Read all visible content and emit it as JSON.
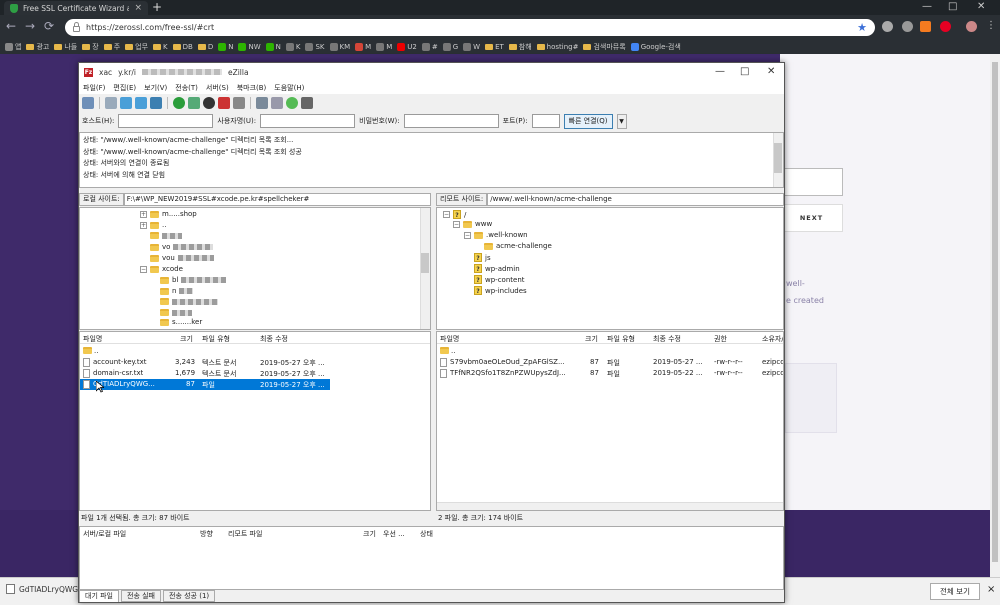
{
  "browser": {
    "tab_title": "Free SSL Certificate Wizard and",
    "new_tab": "+",
    "window_controls": [
      "—",
      "□",
      "✕"
    ],
    "url": "https://zerossl.com/free-ssl/#crt",
    "bookmarks": [
      {
        "label": "앱",
        "icon": "apps-icon"
      },
      {
        "label": "광고",
        "icon": "folder-icon"
      },
      {
        "label": "나들",
        "icon": "folder-icon"
      },
      {
        "label": "장",
        "icon": "folder-icon"
      },
      {
        "label": "주",
        "icon": "folder-icon"
      },
      {
        "label": "업무",
        "icon": "folder-icon"
      },
      {
        "label": "K",
        "icon": "folder-icon"
      },
      {
        "label": "DB",
        "icon": "folder-icon"
      },
      {
        "label": "D",
        "icon": "folder-icon"
      },
      {
        "label": "N",
        "icon": "naver-icon"
      },
      {
        "label": "NW",
        "icon": "naver-icon"
      },
      {
        "label": "N",
        "icon": "naver-icon"
      },
      {
        "label": "K",
        "icon": "site-icon"
      },
      {
        "label": "SK",
        "icon": "site-icon"
      },
      {
        "label": "KM",
        "icon": "site-icon"
      },
      {
        "label": "M",
        "icon": "gmail-icon"
      },
      {
        "label": "M",
        "icon": "site-icon"
      },
      {
        "label": "U2",
        "icon": "youtube-icon"
      },
      {
        "label": "#",
        "icon": "site-icon"
      },
      {
        "label": "G",
        "icon": "site-icon"
      },
      {
        "label": "W",
        "icon": "site-icon"
      },
      {
        "label": "ET",
        "icon": "folder-icon"
      },
      {
        "label": "참해",
        "icon": "folder-icon"
      },
      {
        "label": "hosting#",
        "icon": "folder-icon"
      },
      {
        "label": "검색마뮤록",
        "icon": "folder-icon"
      },
      {
        "label": "Google-검색",
        "icon": "google-icon"
      }
    ],
    "download": {
      "filename": "GdTIADLryQWG...",
      "show_all": "전체 보기"
    }
  },
  "webpage": {
    "next_label": "NEXT",
    "text_frag1": "well-",
    "text_frag2": "e created"
  },
  "filezilla": {
    "title_prefix": "xac",
    "title_mid": "y.kr/i",
    "title_suffix": "eZilla",
    "menu": [
      "파일(F)",
      "편집(E)",
      "보기(V)",
      "전송(T)",
      "서버(S)",
      "북마크(B)",
      "도움말(H)"
    ],
    "quick": {
      "host_label": "호스트(H):",
      "user_label": "사용자명(U):",
      "pass_label": "비밀번호(W):",
      "port_label": "포트(P):",
      "connect_label": "빠른 연결(Q)"
    },
    "log": [
      "상태:  \"/www/.well-known/acme-challenge\" 디렉터리 목록 조회...",
      "상태:  \"/www/.well-known/acme-challenge\" 디렉터리 목록 조회 성공",
      "상태:  서버와의 연결이 종료됨",
      "상태:  서버에 의해 연결 닫힘"
    ],
    "local": {
      "path_label": "로컬 사이트:",
      "path": "F:\\#\\WP_NEW2019#SSL#xcode.pe.kr#spellcheker#",
      "tree": [
        {
          "label": "m.....shop",
          "exp": "+"
        },
        {
          "label": "..",
          "exp": "+"
        },
        {
          "label": "vo",
          "exp": ""
        },
        {
          "label": "vou",
          "exp": ""
        },
        {
          "label": "xcode",
          "exp": "−"
        },
        {
          "label": "bl",
          "exp": ""
        },
        {
          "label": "n",
          "exp": ""
        },
        {
          "label": "",
          "exp": ""
        },
        {
          "label": "",
          "exp": ""
        },
        {
          "label": "s.......ker",
          "exp": ""
        }
      ],
      "columns": [
        "파일명",
        "크기",
        "파일 유형",
        "최종 수정"
      ],
      "files": [
        {
          "name": "..",
          "size": "",
          "type": "",
          "modified": ""
        },
        {
          "name": "account-key.txt",
          "size": "3,243",
          "type": "텍스트 문서",
          "modified": "2019-05-27 오후 ..."
        },
        {
          "name": "domain-csr.txt",
          "size": "1,679",
          "type": "텍스트 문서",
          "modified": "2019-05-27 오후 ..."
        },
        {
          "name": "GdTIADLryQWG...",
          "size": "87",
          "type": "파일",
          "modified": "2019-05-27 오후 ..."
        }
      ],
      "status": "파일 1개 선택됨. 총 크기: 87 바이트"
    },
    "remote": {
      "path_label": "리모트 사이트:",
      "path": "/www/.well-known/acme-challenge",
      "tree": [
        {
          "label": "/",
          "kind": "q"
        },
        {
          "label": "www",
          "kind": "folder"
        },
        {
          "label": ".well-known",
          "kind": "folder"
        },
        {
          "label": "acme-challenge",
          "kind": "folder"
        },
        {
          "label": "js",
          "kind": "q"
        },
        {
          "label": "wp-admin",
          "kind": "q"
        },
        {
          "label": "wp-content",
          "kind": "q"
        },
        {
          "label": "wp-includes",
          "kind": "q"
        }
      ],
      "columns": [
        "파일명",
        "크기",
        "파일 유형",
        "최종 수정",
        "권한",
        "소유자/그"
      ],
      "files": [
        {
          "name": "..",
          "size": "",
          "type": "",
          "modified": "",
          "perm": "",
          "owner": ""
        },
        {
          "name": "S79vbm0aeOLeOud_ZpAFGlSZ...",
          "size": "87",
          "type": "파일",
          "modified": "2019-05-27 ...",
          "perm": "-rw-r--r--",
          "owner": "ezipcoo"
        },
        {
          "name": "TFfNR2QSfo1T8ZnPZWUpysZdJ...",
          "size": "87",
          "type": "파일",
          "modified": "2019-05-22 ...",
          "perm": "-rw-r--r--",
          "owner": "ezipcoo"
        }
      ],
      "status": "2 파일. 총 크기: 174 바이트"
    },
    "queue": {
      "columns": [
        "서버/로컬 파일",
        "방향",
        "리모트 파일",
        "크기",
        "우선 ...",
        "상태"
      ],
      "tabs": [
        "대기 파일",
        "전송 실패",
        "전송 성공 (1)"
      ]
    }
  }
}
